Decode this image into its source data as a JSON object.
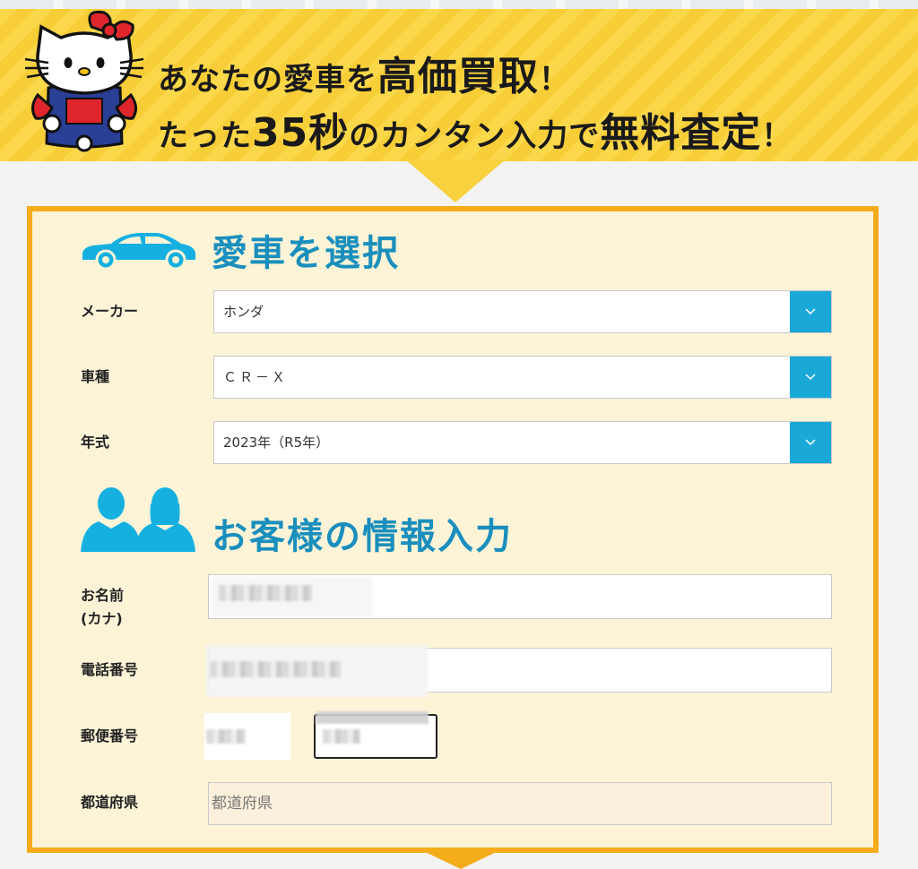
{
  "banner": {
    "line1_pre": "あなたの愛車を",
    "line1_big": "高価買取",
    "line1_post": "！",
    "line2_pre": "たった",
    "line2_big": "35秒",
    "line2_mid": "のカンタン入力で",
    "line2_big2": "無料査定",
    "line2_post": "！"
  },
  "car_section": {
    "title": "愛車を選択",
    "maker_label": "メーカー",
    "maker_value": "ホンダ",
    "model_label": "車種",
    "model_value": "ＣＲ－Ｘ",
    "year_label": "年式",
    "year_value": "2023年（R5年）"
  },
  "customer_section": {
    "title": "お客様の情報入力",
    "name_label_1": "お名前",
    "name_label_2": "(カナ)",
    "phone_label": "電話番号",
    "zip_label": "郵便番号",
    "pref_label": "都道府県",
    "pref_placeholder": "都道府県"
  },
  "colors": {
    "accent": "#1aa8d9",
    "title_blue": "#1a8fbd",
    "panel_border": "#f5ac1b",
    "banner_yellow": "#fbd84a"
  }
}
